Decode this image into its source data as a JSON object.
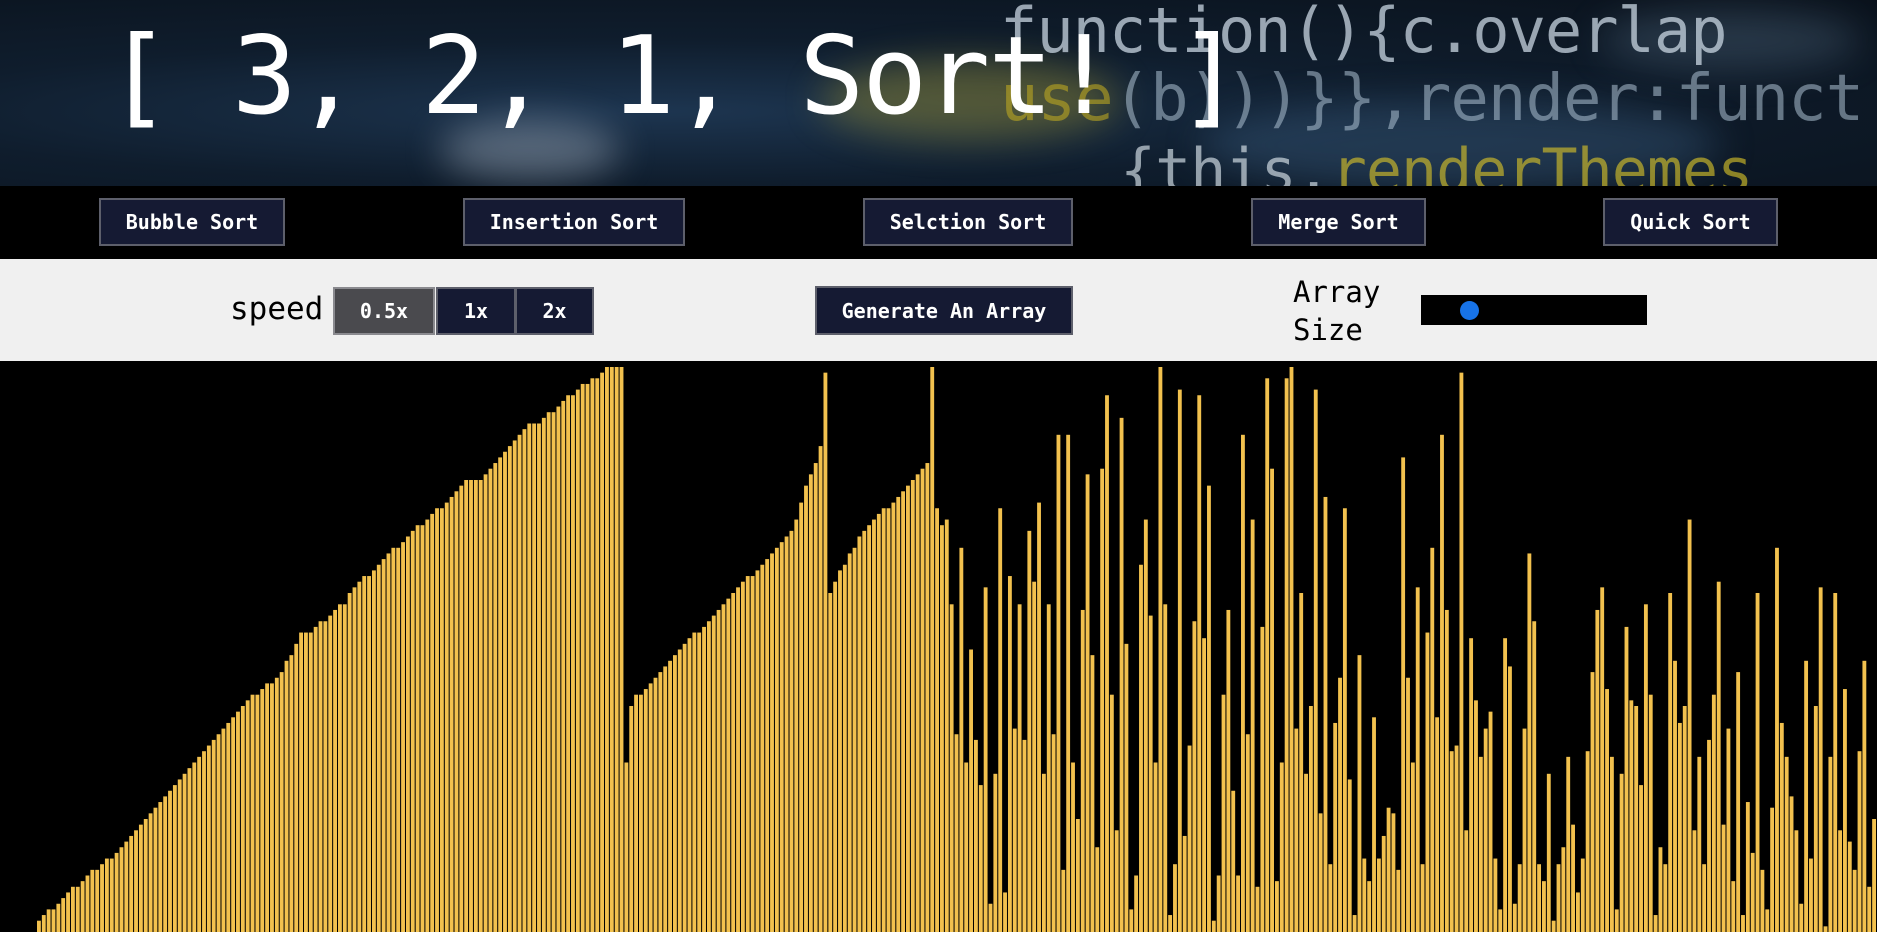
{
  "header": {
    "title": "[ 3, 2, 1, Sort! ]"
  },
  "algorithms": [
    {
      "label": "Bubble Sort"
    },
    {
      "label": "Insertion Sort"
    },
    {
      "label": "Selction Sort"
    },
    {
      "label": "Merge Sort"
    },
    {
      "label": "Quick Sort"
    }
  ],
  "controls": {
    "speed_label": "speed",
    "speed_options": [
      "0.5x",
      "1x",
      "2x"
    ],
    "selected_speed": "0.5x",
    "generate_label": "Generate An Array",
    "array_size_label": "Array Size",
    "array_size_level": 0.15
  },
  "colors": {
    "bar": "#f2c14e",
    "bar_outline": "#000000",
    "button_bg": "#151a33",
    "slider_thumb": "#1773e8"
  },
  "chart_data": {
    "type": "bar",
    "values": [
      2,
      3,
      4,
      4,
      5,
      6,
      7,
      8,
      8,
      9,
      10,
      11,
      11,
      12,
      13,
      13,
      14,
      15,
      16,
      17,
      18,
      19,
      20,
      21,
      22,
      23,
      24,
      25,
      26,
      27,
      28,
      29,
      30,
      31,
      32,
      33,
      34,
      35,
      36,
      37,
      38,
      39,
      40,
      41,
      42,
      42,
      43,
      44,
      44,
      45,
      46,
      48,
      49,
      51,
      53,
      53,
      53,
      54,
      55,
      55,
      56,
      57,
      58,
      58,
      60,
      61,
      62,
      63,
      63,
      64,
      65,
      66,
      67,
      68,
      68,
      69,
      70,
      71,
      72,
      72,
      73,
      74,
      75,
      75,
      76,
      77,
      78,
      79,
      80,
      80,
      80,
      80,
      81,
      82,
      83,
      84,
      85,
      86,
      87,
      88,
      89,
      90,
      90,
      90,
      91,
      92,
      92,
      93,
      94,
      95,
      95,
      96,
      97,
      97,
      98,
      98,
      99,
      100,
      100,
      100,
      100,
      30,
      40,
      42,
      42,
      43,
      44,
      45,
      46,
      47,
      48,
      49,
      50,
      51,
      52,
      53,
      53,
      54,
      55,
      56,
      57,
      58,
      59,
      60,
      61,
      62,
      63,
      63,
      64,
      65,
      66,
      67,
      68,
      69,
      70,
      71,
      73,
      76,
      79,
      81,
      83,
      86,
      99,
      60,
      62,
      64,
      65,
      67,
      68,
      70,
      71,
      72,
      73,
      74,
      75,
      75,
      76,
      77,
      78,
      79,
      80,
      81,
      82,
      83,
      100,
      75,
      72,
      73,
      58,
      35,
      68,
      30,
      50,
      34,
      26,
      61,
      5,
      28,
      75,
      7,
      63,
      36,
      58,
      34,
      71,
      62,
      76,
      28,
      58,
      35,
      88,
      11,
      88,
      30,
      20,
      57,
      81,
      49,
      15,
      82,
      95,
      42,
      18,
      91,
      51,
      4,
      10,
      65,
      73,
      56,
      30,
      100,
      58,
      3,
      12,
      96,
      17,
      33,
      55,
      95,
      52,
      79,
      2,
      10,
      42,
      57,
      25,
      10,
      88,
      35,
      73,
      8,
      54,
      98,
      82,
      9,
      30,
      98,
      100,
      36,
      60,
      28,
      40,
      96,
      21,
      77,
      12,
      37,
      45,
      75,
      27,
      3,
      49,
      13,
      9,
      38,
      13,
      17,
      22,
      21,
      11,
      84,
      45,
      30,
      61,
      12,
      53,
      68,
      38,
      88,
      57,
      32,
      33,
      99,
      18,
      52,
      41,
      31,
      36,
      39,
      13,
      4,
      52,
      47,
      5,
      12,
      36,
      67,
      55,
      12,
      9,
      28,
      2,
      12,
      15,
      31,
      19,
      7,
      13,
      32,
      46,
      57,
      61,
      43,
      31,
      4,
      28,
      54,
      41,
      40,
      26,
      58,
      42,
      3,
      15,
      12,
      60,
      48,
      37,
      40,
      73,
      18,
      31,
      12,
      34,
      42,
      62,
      19,
      36,
      9,
      46,
      3,
      23,
      14,
      60,
      11,
      4,
      22,
      68,
      37,
      31,
      24,
      18,
      5,
      48,
      13,
      40,
      61,
      1,
      31,
      60,
      18,
      43,
      16,
      11,
      32,
      48,
      8,
      20
    ],
    "ylim": [
      0,
      100
    ]
  }
}
